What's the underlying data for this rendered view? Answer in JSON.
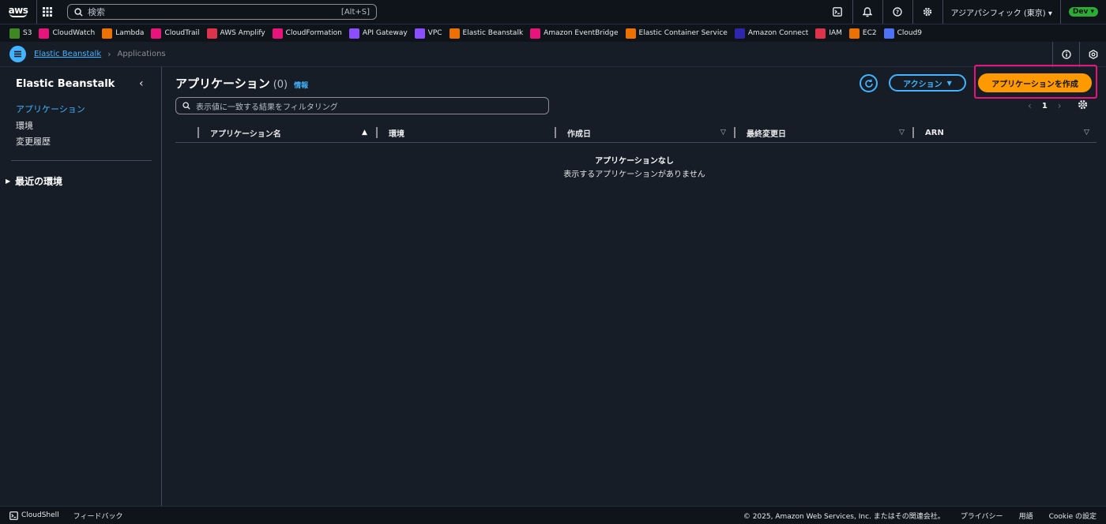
{
  "topnav": {
    "logo": "aws",
    "search_placeholder": "検索",
    "search_shortcut": "[Alt+S]",
    "region": "アジアパシフィック (東京) ▾",
    "account_badge": "Dev ▾"
  },
  "favorites": [
    {
      "label": "S3",
      "color": "#3f8624",
      "icon": "s3-icon"
    },
    {
      "label": "CloudWatch",
      "color": "#e7157b",
      "icon": "cloudwatch-icon"
    },
    {
      "label": "Lambda",
      "color": "#ed7100",
      "icon": "lambda-icon"
    },
    {
      "label": "CloudTrail",
      "color": "#e7157b",
      "icon": "cloudtrail-icon"
    },
    {
      "label": "AWS Amplify",
      "color": "#dd344c",
      "icon": "amplify-icon"
    },
    {
      "label": "CloudFormation",
      "color": "#e7157b",
      "icon": "cloudformation-icon"
    },
    {
      "label": "API Gateway",
      "color": "#8c4fff",
      "icon": "api-gateway-icon"
    },
    {
      "label": "VPC",
      "color": "#8c4fff",
      "icon": "vpc-icon"
    },
    {
      "label": "Elastic Beanstalk",
      "color": "#ed7100",
      "icon": "beanstalk-icon"
    },
    {
      "label": "Amazon EventBridge",
      "color": "#e7157b",
      "icon": "eventbridge-icon"
    },
    {
      "label": "Elastic Container Service",
      "color": "#ed7100",
      "icon": "ecs-icon"
    },
    {
      "label": "Amazon Connect",
      "color": "#2e27ad",
      "icon": "connect-icon"
    },
    {
      "label": "IAM",
      "color": "#dd344c",
      "icon": "iam-icon"
    },
    {
      "label": "EC2",
      "color": "#ed7100",
      "icon": "ec2-icon"
    },
    {
      "label": "Cloud9",
      "color": "#4d72f3",
      "icon": "cloud9-icon"
    }
  ],
  "breadcrumb": {
    "service": "Elastic Beanstalk",
    "current": "Applications"
  },
  "sidebar": {
    "title": "Elastic Beanstalk",
    "items": [
      {
        "label": "アプリケーション"
      },
      {
        "label": "環境"
      },
      {
        "label": "変更履歴"
      }
    ],
    "section": "最近の環境"
  },
  "main": {
    "title": "アプリケーション",
    "count": "(0)",
    "info": "情報",
    "actions_label": "アクション",
    "create_label": "アプリケーションを作成",
    "filter_placeholder": "表示値に一致する結果をフィルタリング",
    "page": "1",
    "columns": [
      "アプリケーション名",
      "環境",
      "作成日",
      "最終変更日",
      "ARN"
    ],
    "empty_title": "アプリケーションなし",
    "empty_subtitle": "表示するアプリケーションがありません"
  },
  "footer": {
    "cloudshell": "CloudShell",
    "feedback": "フィードバック",
    "copyright": "© 2025, Amazon Web Services, Inc. またはその関連会社。",
    "privacy": "プライバシー",
    "terms": "用語",
    "cookie": "Cookie の設定"
  },
  "colors": {
    "accent": "#42b4ff",
    "primary_button": "#ff9900",
    "highlight_border": "#e7157b"
  }
}
